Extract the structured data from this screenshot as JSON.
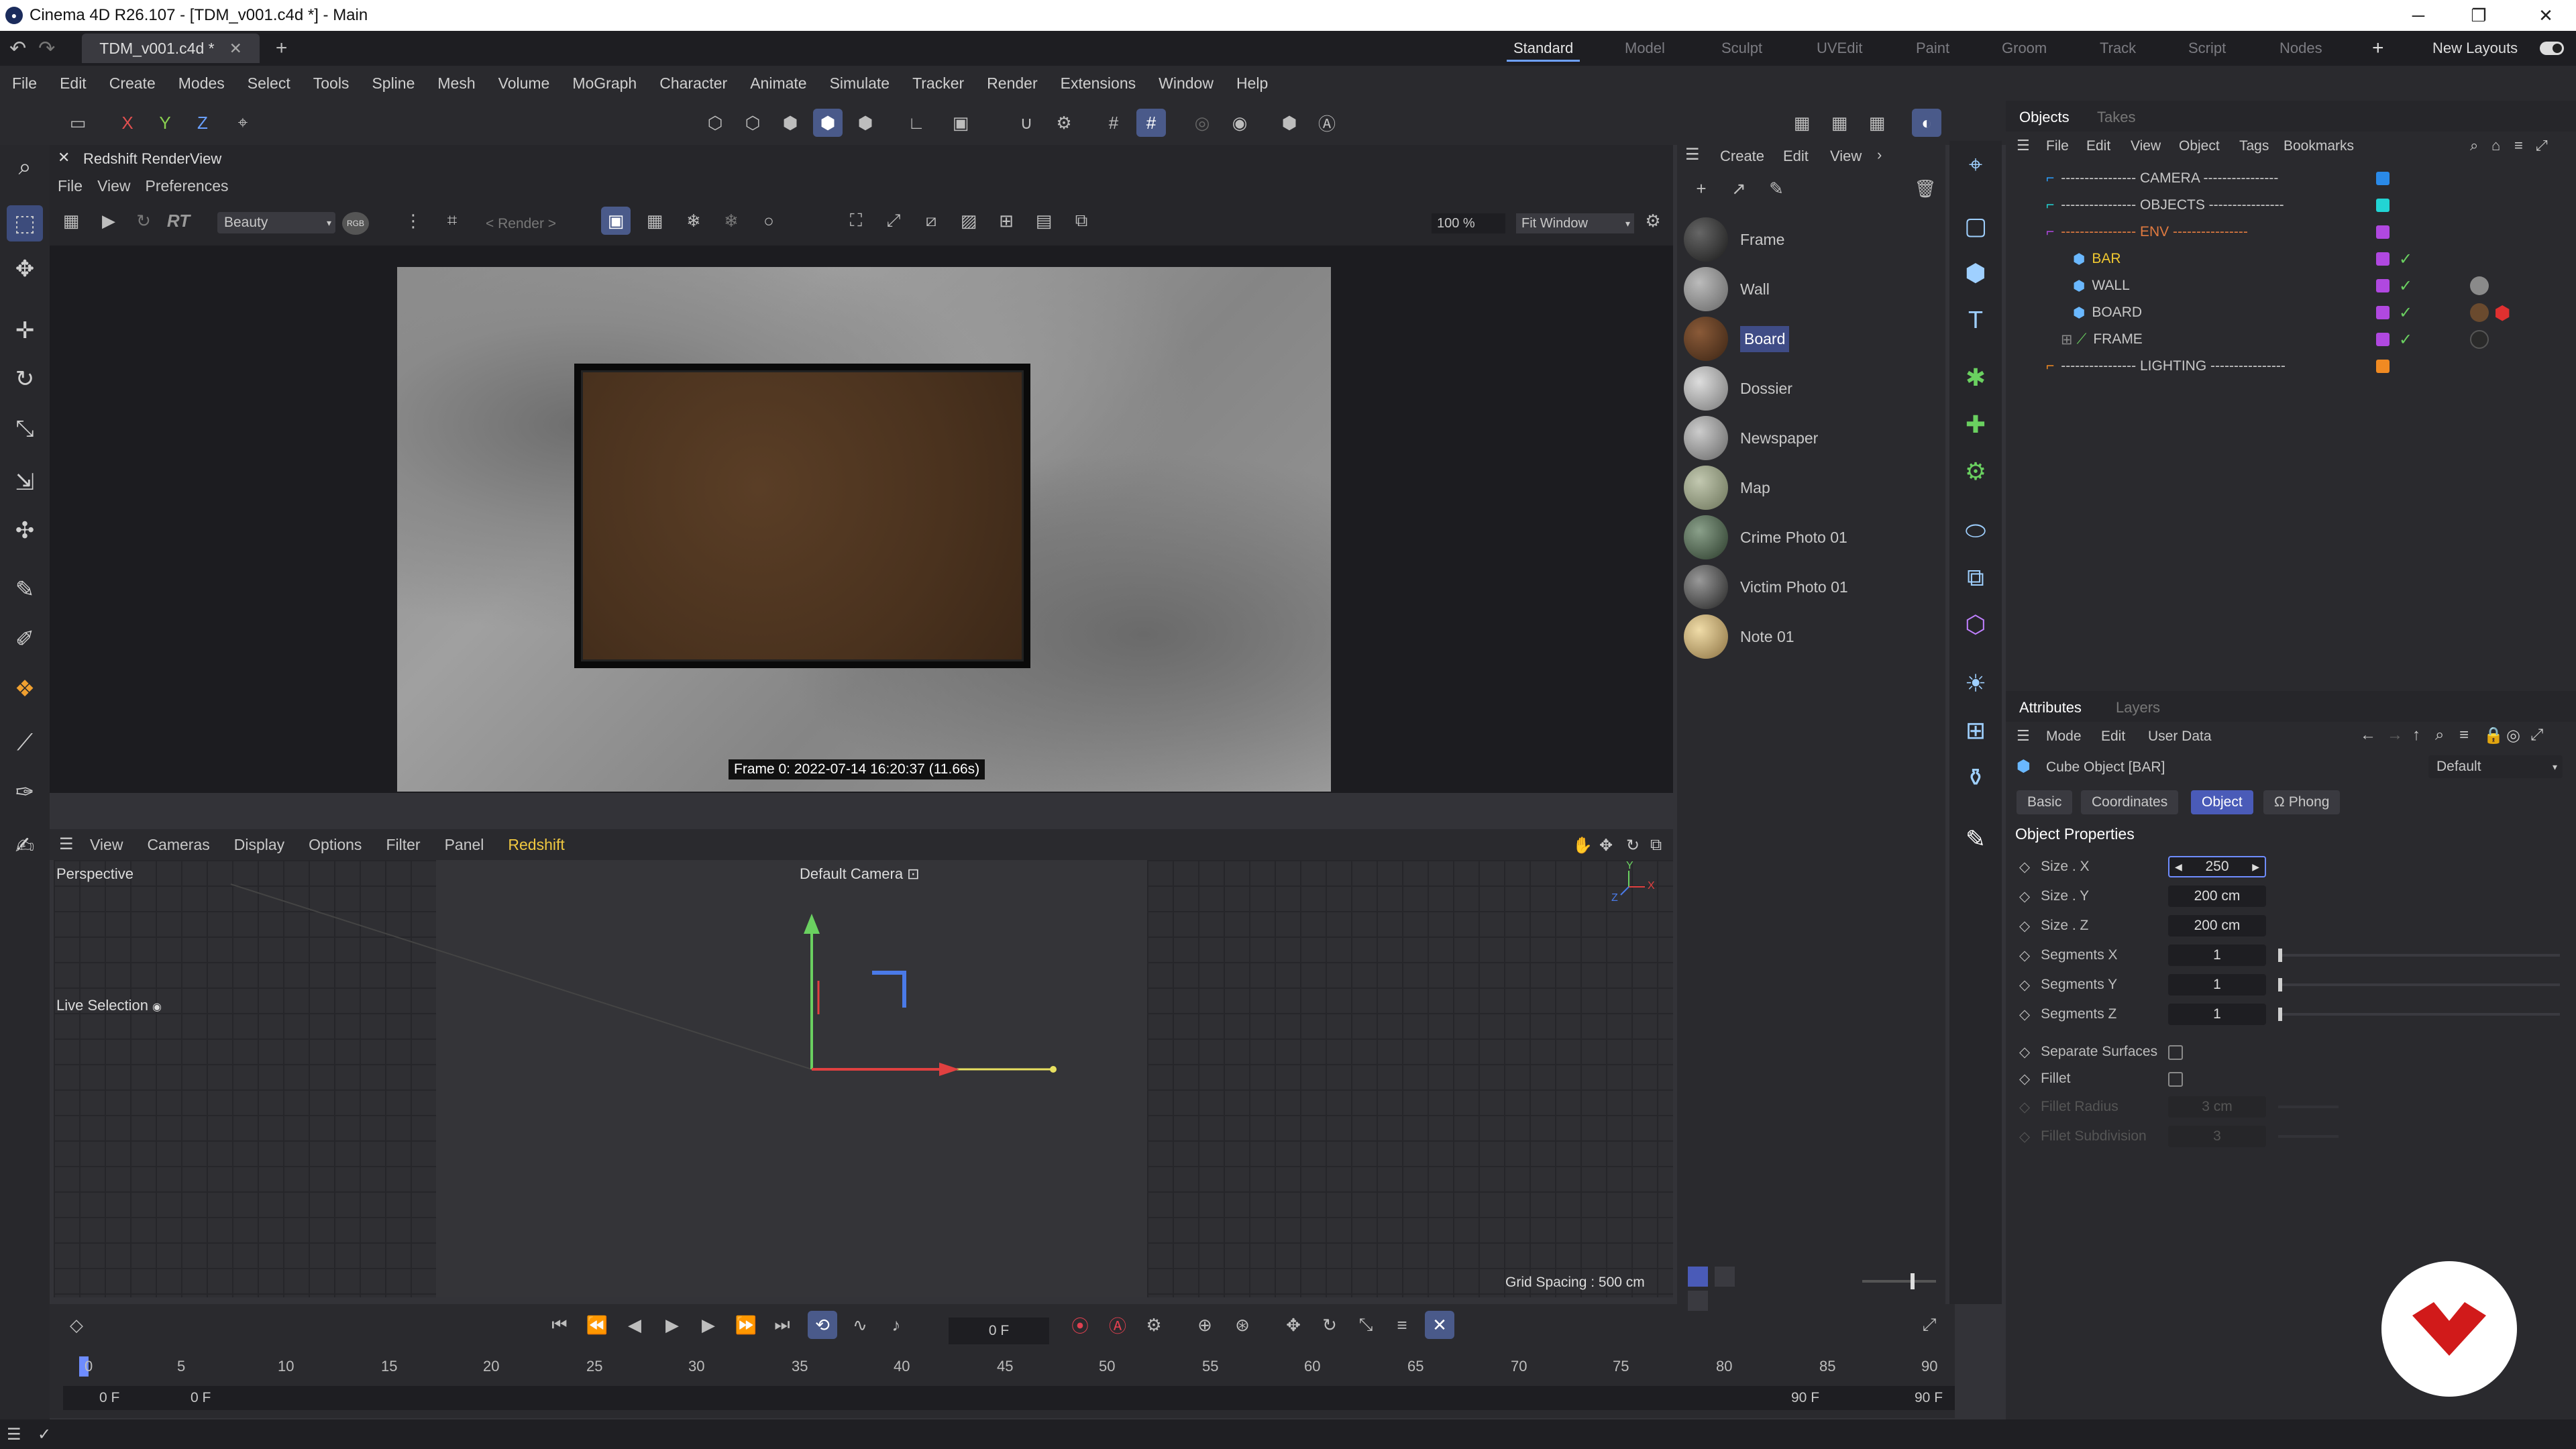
{
  "window": {
    "title": "Cinema 4D R26.107 - [TDM_v001.c4d *] - Main",
    "minimize": "─",
    "maximize": "❐",
    "close": "✕"
  },
  "doc_tab": "TDM_v001.c4d *",
  "layouts": [
    "Standard",
    "Model",
    "Sculpt",
    "UVEdit",
    "Paint",
    "Groom",
    "Track",
    "Script",
    "Nodes"
  ],
  "active_layout": "Standard",
  "new_layouts": "New Layouts",
  "menu": [
    "File",
    "Edit",
    "Create",
    "Modes",
    "Select",
    "Tools",
    "Spline",
    "Mesh",
    "Volume",
    "MoGraph",
    "Character",
    "Animate",
    "Simulate",
    "Tracker",
    "Render",
    "Extensions",
    "Window",
    "Help"
  ],
  "axis_lock": [
    "X",
    "Y",
    "Z"
  ],
  "renderview": {
    "title": "Redshift RenderView",
    "menu": [
      "File",
      "View",
      "Preferences"
    ],
    "rt": "RT",
    "aov": "Beauty",
    "rgb": "RGB",
    "render_select": "< Render >",
    "zoom": "100 %",
    "fit": "Fit Window",
    "stamp": "Frame  0:  2022-07-14  16:20:37  (11.66s)"
  },
  "viewport": {
    "menu": [
      "View",
      "Cameras",
      "Display",
      "Options",
      "Filter",
      "Panel",
      "Redshift"
    ],
    "panels": {
      "left": "Perspective",
      "camera": "Default Camera"
    },
    "camera_icon": "⊡",
    "tool": "Live Selection",
    "grid_spacing": "Grid Spacing : 500 cm",
    "axis_y": "Y",
    "axis_x": "X",
    "axis_z": "Z"
  },
  "materials": {
    "menu": [
      "Create",
      "Edit",
      "View"
    ],
    "items": [
      {
        "name": "Frame",
        "color": "#3b3b3b"
      },
      {
        "name": "Wall",
        "color": "#8d8d8d"
      },
      {
        "name": "Board",
        "color": "#5c3b24",
        "selected": true
      },
      {
        "name": "Dossier",
        "color": "#a8a8a8"
      },
      {
        "name": "Newspaper",
        "color": "#9a9a9a"
      },
      {
        "name": "Map",
        "color": "#8a9478"
      },
      {
        "name": "Crime Photo 01",
        "color": "#556855"
      },
      {
        "name": "Victim Photo 01",
        "color": "#4a4a4a"
      },
      {
        "name": "Note 01",
        "color": "#c9b48a"
      }
    ]
  },
  "objects": {
    "tabs": [
      "Objects",
      "Takes"
    ],
    "menu": [
      "File",
      "Edit",
      "View",
      "Object",
      "Tags",
      "Bookmarks"
    ],
    "rows": [
      {
        "label": "---------------- CAMERA ----------------",
        "color": "#2aa0ff",
        "swatch": "#2a8ae8"
      },
      {
        "label": "---------------- OBJECTS ----------------",
        "color": "#4ad6e8",
        "swatch": "#22d4d4"
      },
      {
        "label": "---------------- ENV ----------------",
        "color": "#d06adf",
        "swatch": "#b048e0"
      },
      {
        "label": "BAR",
        "color": "#f0c830",
        "swatch": "#b048e0"
      },
      {
        "label": "WALL",
        "color": "#cfcfcf",
        "swatch": "#b048e0"
      },
      {
        "label": "BOARD",
        "color": "#cfcfcf",
        "swatch": "#b048e0"
      },
      {
        "label": "FRAME",
        "color": "#cfcfcf",
        "swatch": "#b048e0"
      },
      {
        "label": "---------------- LIGHTING ----------------",
        "color": "#cfcfcf",
        "swatch": "#f08a22"
      }
    ]
  },
  "attributes": {
    "tabs": [
      "Attributes",
      "Layers"
    ],
    "menu": [
      "Mode",
      "Edit",
      "User Data"
    ],
    "object_name": "Cube Object [BAR]",
    "preset": "Default",
    "subtabs": [
      "Basic",
      "Coordinates",
      "Object",
      "Phong"
    ],
    "active_subtab": "Object",
    "section": "Object Properties",
    "props": [
      {
        "label": "Size . X",
        "value": "250"
      },
      {
        "label": "Size . Y",
        "value": "200 cm"
      },
      {
        "label": "Size . Z",
        "value": "200 cm"
      },
      {
        "label": "Segments X",
        "value": "1"
      },
      {
        "label": "Segments Y",
        "value": "1"
      },
      {
        "label": "Segments Z",
        "value": "1"
      }
    ],
    "checks": [
      {
        "label": "Separate Surfaces"
      },
      {
        "label": "Fillet"
      }
    ],
    "disabled": [
      {
        "label": "Fillet Radius",
        "value": "3 cm"
      },
      {
        "label": "Fillet Subdivision",
        "value": "3"
      }
    ]
  },
  "timeline": {
    "current_frame": "0 F",
    "ticks": [
      "0",
      "5",
      "10",
      "15",
      "20",
      "25",
      "30",
      "35",
      "40",
      "45",
      "50",
      "55",
      "60",
      "65",
      "70",
      "75",
      "80",
      "85",
      "90"
    ],
    "start": "0 F",
    "start2": "0 F",
    "end": "90 F",
    "end2": "90 F"
  }
}
